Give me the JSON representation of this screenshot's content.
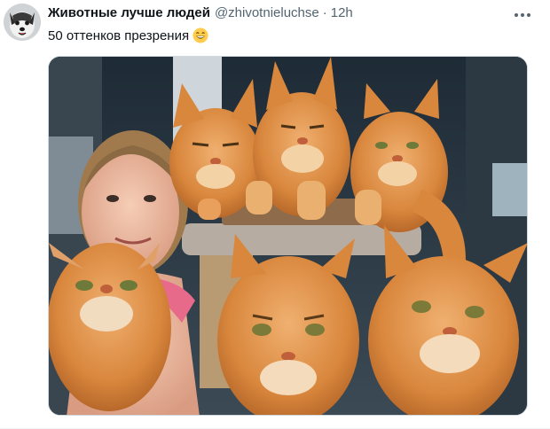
{
  "tweet": {
    "display_name": "Животные лучше людей",
    "handle": "@zhivotnieluchse",
    "separator": "·",
    "time": "12h",
    "text": "50 оттенков презрения",
    "emoji_icon": "grinning-face-emoji",
    "more_icon": "more-options-icon",
    "avatar_icon": "dog-avatar",
    "media_description_icon": "photo-woman-with-five-ginger-maine-coon-cats"
  },
  "colors": {
    "name": "#0f1419",
    "meta": "#536471",
    "border": "#cfd9de",
    "cat_fur": "#d9873d"
  }
}
